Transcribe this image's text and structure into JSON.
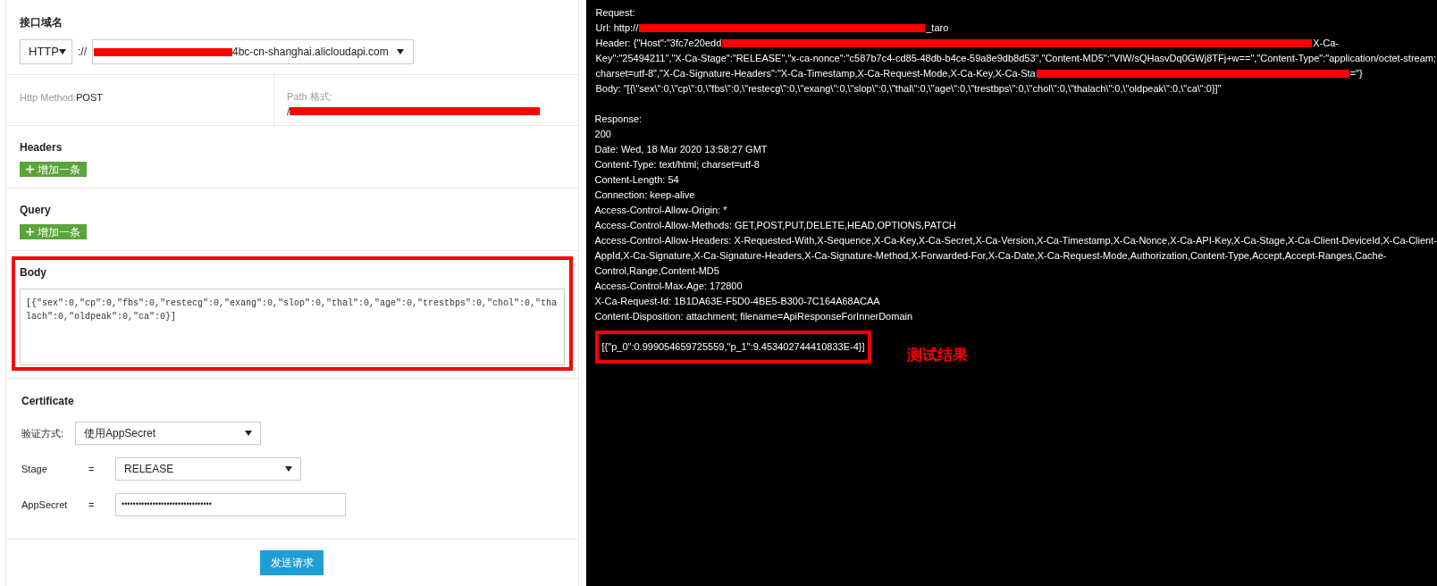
{
  "domain_section": {
    "title": "接口域名",
    "protocol": "HTTP",
    "separator": "://",
    "host_suffix": "4bc-cn-shanghai.alicloudapi.com"
  },
  "method": {
    "label": "Http Method:",
    "value": "POST"
  },
  "path": {
    "label": "Path 格式:",
    "value_prefix": "/"
  },
  "headers": {
    "title": "Headers",
    "add_button": "增加一条"
  },
  "query": {
    "title": "Query",
    "add_button": "增加一条"
  },
  "body": {
    "title": "Body",
    "value": "[{\"sex\":0,\"cp\":0,\"fbs\":0,\"restecg\":0,\"exang\":0,\"slop\":0,\"thal\":0,\"age\":0,\"trestbps\":0,\"chol\":0,\"thalach\":0,\"oldpeak\":0,\"ca\":0}]",
    "highlighted": true
  },
  "certificate": {
    "title": "Certificate",
    "fields": [
      {
        "kind": "select",
        "label": "验证方式:",
        "value": "使用AppSecret"
      },
      {
        "kind": "select",
        "label": "Stage",
        "operator": "=",
        "value": "RELEASE"
      },
      {
        "kind": "secret",
        "label": "AppSecret",
        "operator": "=",
        "value": "••••••••••••••••••••••••••••••••"
      }
    ]
  },
  "send_button": "发送请求",
  "console": {
    "request_lines": [
      [
        {
          "kind": "text",
          "text": "Request:"
        }
      ],
      [
        {
          "kind": "text",
          "text": "Url: http://"
        },
        {
          "kind": "redaction"
        },
        {
          "kind": "text",
          "text": "_taro"
        }
      ],
      [
        {
          "kind": "text",
          "text": "Header: {\"Host\":\"3fc7e20edd"
        },
        {
          "kind": "redaction"
        },
        {
          "kind": "text",
          "text": "X-Ca-"
        }
      ],
      [
        {
          "kind": "text",
          "text": "Key\":\"25494211\",\"X-Ca-Stage\":\"RELEASE\",\"x-ca-nonce\":\"c587b7c4-cd85-48db-b4ce-59a8e9db8d53\",\"Content-MD5\":\"VIW/sQHasvDq0GWj8TFj+w==\",\"Content-Type\":\"application/octet-stream;"
        }
      ],
      [
        {
          "kind": "text",
          "text": "charset=utf-8\",\"X-Ca-Signature-Headers\":\"X-Ca-Timestamp,X-Ca-Request-Mode,X-Ca-Key,X-Ca-Sta"
        },
        {
          "kind": "redaction"
        },
        {
          "kind": "text",
          "text": "=\"}"
        }
      ],
      [
        {
          "kind": "text",
          "text": "Body: \"[{\\\"sex\\\":0,\\\"cp\\\":0,\\\"fbs\\\":0,\\\"restecg\\\":0,\\\"exang\\\":0,\\\"slop\\\":0,\\\"thal\\\":0,\\\"age\\\":0,\\\"trestbps\\\":0,\\\"chol\\\":0,\\\"thalach\\\":0,\\\"oldpeak\\\":0,\\\"ca\\\":0}]\""
        }
      ]
    ],
    "response_lines": [
      "Response:",
      "200",
      "Date: Wed, 18 Mar 2020 13:58:27 GMT",
      "Content-Type: text/html; charset=utf-8",
      "Content-Length: 54",
      "Connection: keep-alive",
      "Access-Control-Allow-Origin: *",
      "Access-Control-Allow-Methods: GET,POST,PUT,DELETE,HEAD,OPTIONS,PATCH",
      "Access-Control-Allow-Headers: X-Requested-With,X-Sequence,X-Ca-Key,X-Ca-Secret,X-Ca-Version,X-Ca-Timestamp,X-Ca-Nonce,X-Ca-API-Key,X-Ca-Stage,X-Ca-Client-DeviceId,X-Ca-Client-",
      "AppId,X-Ca-Signature,X-Ca-Signature-Headers,X-Ca-Signature-Method,X-Forwarded-For,X-Ca-Date,X-Ca-Request-Mode,Authorization,Content-Type,Accept,Accept-Ranges,Cache-",
      "Control,Range,Content-MD5",
      "Access-Control-Max-Age: 172800",
      "X-Ca-Request-Id: 1B1DA63E-F5D0-4BE5-B300-7C164A68ACAA",
      "Content-Disposition: attachment; filename=ApiResponseForInnerDomain"
    ],
    "result": {
      "text": "[{\"p_0\":0.999054659725559,\"p_1\":9.453402744410833E-4}]",
      "highlighted": true
    },
    "annotation": "测试结果"
  }
}
